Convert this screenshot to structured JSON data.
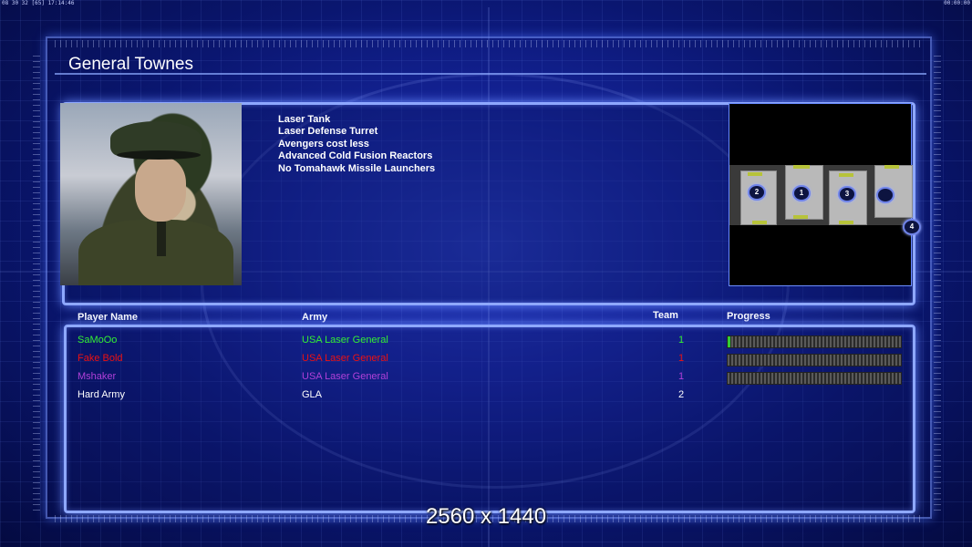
{
  "status_bar": {
    "left": "08 30 32 [65] 17:14:46",
    "right": "00:00:00"
  },
  "general": {
    "name": "General Townes",
    "traits": [
      "Laser Tank",
      "Laser Defense Turret",
      "Avengers cost less",
      "Advanced Cold Fusion Reactors",
      "No Tomahawk Missile Launchers"
    ]
  },
  "minimap": {
    "spawns": [
      "2",
      "1",
      "3",
      "",
      "4"
    ]
  },
  "table": {
    "headers": {
      "player": "Player Name",
      "army": "Army",
      "team": "Team",
      "progress": "Progress"
    },
    "players": [
      {
        "name": "SaMoOo",
        "army": "USA Laser General",
        "team": "1",
        "color": "#33ee33",
        "progress": 0.015
      },
      {
        "name": "Fake  Bold",
        "army": "USA Laser General",
        "team": "1",
        "color": "#ee1111",
        "progress": 0
      },
      {
        "name": "Mshaker",
        "army": "USA Laser General",
        "team": "1",
        "color": "#b040d8",
        "progress": 0
      },
      {
        "name": "Hard Army",
        "army": "GLA",
        "team": "2",
        "color": "#ffffff",
        "progress": null
      }
    ]
  },
  "resolution": "2560 x 1440"
}
